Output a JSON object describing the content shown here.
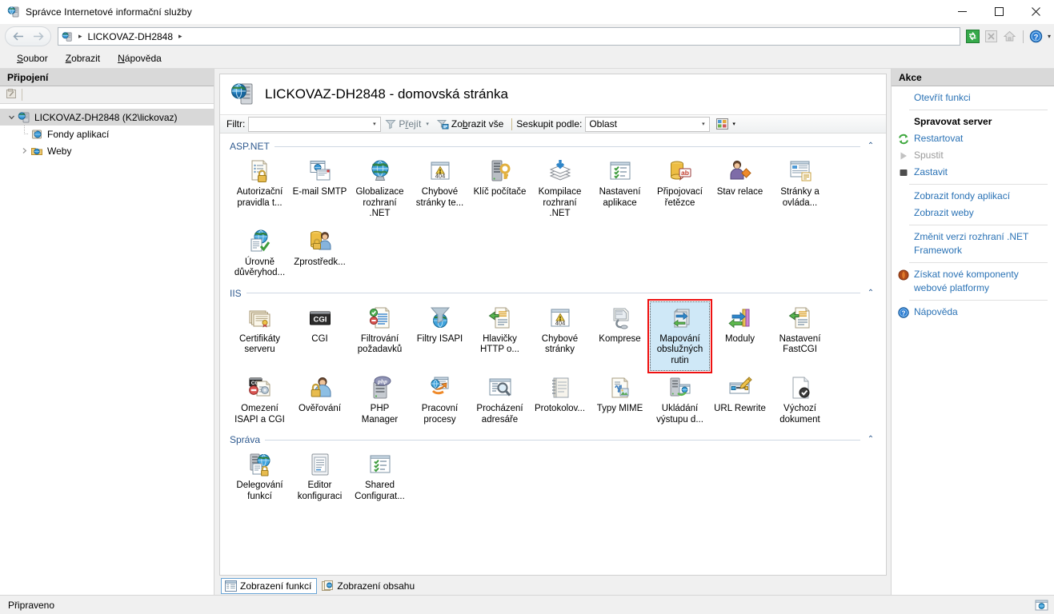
{
  "window": {
    "title": "Správce Internetové informační služby",
    "icon": "iis-server-icon",
    "minimize_label": "Minimalizovat",
    "maximize_label": "Maximalizovat",
    "close_label": "Zavřít"
  },
  "address_bar": {
    "back_label": "Zpět",
    "forward_label": "Vpřed",
    "crumb_icon": "iis-server-icon",
    "crumb_text": "LICKOVAZ-DH2848",
    "separator": "▸",
    "icons": [
      {
        "name": "refresh-icon",
        "title": "Aktualizovat"
      },
      {
        "name": "stop-icon",
        "title": "Zastavit"
      },
      {
        "name": "home-icon",
        "title": "Domů"
      },
      {
        "name": "help-icon",
        "title": "Nápověda"
      }
    ],
    "dropdown_caret": "▾"
  },
  "menu": {
    "items": [
      {
        "label": "Soubor",
        "accel": "S"
      },
      {
        "label": "Zobrazit",
        "accel": "Z"
      },
      {
        "label": "Nápověda",
        "accel": "N"
      }
    ]
  },
  "connections": {
    "header": "Připojení",
    "toolbar": [
      {
        "name": "connect-to-icon",
        "title": "Připojit k"
      }
    ],
    "tree": {
      "root": {
        "label": "LICKOVAZ-DH2848 (K2\\lickovaz)",
        "icon": "iis-server-icon",
        "expanded": true,
        "selected": true,
        "twisty": "⌄"
      },
      "children": [
        {
          "label": "Fondy aplikací",
          "icon": "app-pools-icon",
          "twisty": "",
          "expanded": false
        },
        {
          "label": "Weby",
          "icon": "sites-folder-icon",
          "twisty": "›",
          "expanded": false
        }
      ]
    }
  },
  "content": {
    "page_title": "LICKOVAZ-DH2848 - domovská stránka",
    "page_title_icon": "iis-server-icon",
    "filter_bar": {
      "filter_label": "Filtr:",
      "filter_value": "",
      "filter_placeholder": "",
      "combo_caret": "▾",
      "go_label": "Přejít",
      "go_accel": "ř",
      "go_icon": "funnel-icon",
      "go_caret": "▾",
      "show_all_label": "Zobrazit vše",
      "show_all_accel": "b",
      "show_all_icon": "show-all-icon",
      "group_by_label": "Seskupit podle:",
      "group_by_value": "Oblast",
      "group_by_caret": "▾",
      "view_icon": "view-mode-icon",
      "view_caret": "▾"
    },
    "groups": [
      {
        "name": "ASP.NET",
        "collapse_glyph": "⌃",
        "tiles": [
          {
            "label": "Autorizační pravidla t...",
            "icon": "authorization-rules-icon"
          },
          {
            "label": "E-mail SMTP",
            "icon": "smtp-email-icon"
          },
          {
            "label": "Globalizace rozhraní .NET",
            "icon": "net-globalization-icon"
          },
          {
            "label": "Chybové stránky te...",
            "icon": "error-pages-404-icon"
          },
          {
            "label": "Klíč počítače",
            "icon": "machine-key-icon"
          },
          {
            "label": "Kompilace rozhraní .NET",
            "icon": "net-compilation-icon"
          },
          {
            "label": "Nastavení aplikace",
            "icon": "application-settings-icon"
          },
          {
            "label": "Připojovací řetězce",
            "icon": "connection-strings-icon"
          },
          {
            "label": "Stav relace",
            "icon": "session-state-icon"
          },
          {
            "label": "Stránky a ovláda...",
            "icon": "pages-and-controls-icon"
          },
          {
            "label": "Úrovně důvěryhod...",
            "icon": "trust-levels-icon"
          },
          {
            "label": "Zprostředk...",
            "icon": "providers-icon"
          }
        ]
      },
      {
        "name": "IIS",
        "collapse_glyph": "⌃",
        "tiles": [
          {
            "label": "Certifikáty serveru",
            "icon": "server-certificates-icon"
          },
          {
            "label": "CGI",
            "icon": "cgi-icon"
          },
          {
            "label": "Filtrování požadavků",
            "icon": "request-filtering-icon"
          },
          {
            "label": "Filtry ISAPI",
            "icon": "isapi-filters-icon"
          },
          {
            "label": "Hlavičky HTTP o...",
            "icon": "http-response-headers-icon"
          },
          {
            "label": "Chybové stránky",
            "icon": "error-pages-404-icon"
          },
          {
            "label": "Komprese",
            "icon": "compression-icon"
          },
          {
            "label": "Mapování obslužných rutin",
            "icon": "handler-mappings-icon",
            "selected": true,
            "highlighted": true
          },
          {
            "label": "Moduly",
            "icon": "modules-icon"
          },
          {
            "label": "Nastavení FastCGI",
            "icon": "fastcgi-settings-icon"
          },
          {
            "label": "Omezení ISAPI a CGI",
            "icon": "isapi-cgi-restrictions-icon"
          },
          {
            "label": "Ověřování",
            "icon": "authentication-icon"
          },
          {
            "label": "PHP Manager",
            "icon": "php-manager-icon"
          },
          {
            "label": "Pracovní procesy",
            "icon": "worker-processes-icon"
          },
          {
            "label": "Procházení adresáře",
            "icon": "directory-browsing-icon"
          },
          {
            "label": "Protokolov...",
            "icon": "logging-icon"
          },
          {
            "label": "Typy MIME",
            "icon": "mime-types-icon"
          },
          {
            "label": "Ukládání výstupu d...",
            "icon": "output-caching-icon"
          },
          {
            "label": "URL Rewrite",
            "icon": "url-rewrite-icon"
          },
          {
            "label": "Výchozí dokument",
            "icon": "default-document-icon"
          }
        ]
      },
      {
        "name": "Správa",
        "collapse_glyph": "⌃",
        "tiles": [
          {
            "label": "Delegování funkcí",
            "icon": "feature-delegation-icon"
          },
          {
            "label": "Editor konfiguraci",
            "icon": "configuration-editor-icon"
          },
          {
            "label": "Shared Configurat...",
            "icon": "shared-configuration-icon"
          }
        ]
      }
    ],
    "view_tabs": [
      {
        "label": "Zobrazení funkcí",
        "icon": "features-view-icon",
        "active": true
      },
      {
        "label": "Zobrazení obsahu",
        "icon": "content-view-icon",
        "active": false
      }
    ]
  },
  "actions": {
    "header": "Akce",
    "items": [
      {
        "label": "Otevřít funkci",
        "icon": "",
        "style": "link"
      },
      {
        "divider": true
      },
      {
        "label": "Spravovat server",
        "icon": "",
        "style": "bold"
      },
      {
        "label": "Restartovat",
        "icon": "restart-icon",
        "style": "link"
      },
      {
        "label": "Spustit",
        "icon": "start-icon",
        "style": "disabled"
      },
      {
        "label": "Zastavit",
        "icon": "stop-square-icon",
        "style": "link"
      },
      {
        "divider": true
      },
      {
        "label": "Zobrazit fondy aplikací",
        "icon": "",
        "style": "link"
      },
      {
        "label": "Zobrazit weby",
        "icon": "",
        "style": "link"
      },
      {
        "divider": true
      },
      {
        "label": "Změnit verzi rozhraní .NET Framework",
        "icon": "",
        "style": "link"
      },
      {
        "divider": true
      },
      {
        "label": "Získat nové komponenty webové platformy",
        "icon": "web-platform-icon",
        "style": "link"
      },
      {
        "divider": true
      },
      {
        "label": "Nápověda",
        "icon": "help-round-icon",
        "style": "link"
      }
    ]
  },
  "status_bar": {
    "text": "Připraveno",
    "grip_icon": "resize-grip-icon"
  },
  "colors": {
    "accent_link": "#2a72b5",
    "group_heading": "#2f5a8f",
    "selection_fill": "#cfe8f7",
    "highlight_box": "#ee1111",
    "pane_header_bg": "#d9d9d9"
  }
}
